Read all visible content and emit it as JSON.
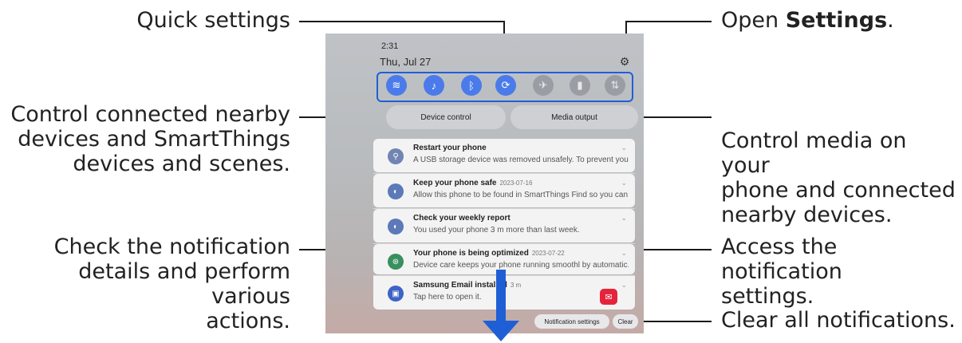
{
  "annotations": {
    "quick_settings": "Quick settings",
    "open_settings_prefix": "Open ",
    "open_settings_bold": "Settings",
    "open_settings_suffix": ".",
    "control_connected_l1": "Control connected nearby",
    "control_connected_l2": "devices and SmartThings",
    "control_connected_l3": "devices and scenes.",
    "control_media_l1": "Control media on your",
    "control_media_l2": "phone and connected",
    "control_media_l3": "nearby devices.",
    "check_notif_l1": "Check the notification",
    "check_notif_l2": "details and perform various",
    "check_notif_l3": "actions.",
    "access_notif_l1": "Access the notification",
    "access_notif_l2": "settings.",
    "clear_all": "Clear all notifications."
  },
  "phone": {
    "time": "2:31",
    "date": "Thu, Jul 27",
    "quick_settings_icons": [
      "wifi-icon",
      "sound-icon",
      "bluetooth-icon",
      "auto-rotate-icon",
      "airplane-mode-icon",
      "flashlight-icon",
      "mobile-data-icon"
    ],
    "device_control_label": "Device control",
    "media_output_label": "Media output",
    "notifications": [
      {
        "title": "Restart your phone",
        "date": "",
        "body": "A USB storage device was removed unsafely. To prevent your ...",
        "icon": "usb-icon"
      },
      {
        "title": "Keep your phone safe",
        "date": "2023-07-16",
        "body": "Allow this phone to be found in SmartThings Find so you can l...",
        "icon": "shield-icon"
      },
      {
        "title": "Check your weekly report",
        "date": "",
        "body": "You used your phone 3 m more than last week.",
        "icon": "report-icon"
      },
      {
        "title": "Your phone is being optimized",
        "date": "2023-07-22",
        "body": "Device care keeps your phone running smoothl  by automatic...",
        "icon": "device-care-icon"
      },
      {
        "title": "Samsung Email installed",
        "date": "3 m",
        "body": "Tap here to open it.",
        "icon": "bag-icon"
      }
    ],
    "notification_settings_label": "Notification settings",
    "clear_label": "Clear"
  },
  "colors": {
    "accent_blue": "#1f5fd6",
    "qs_active": "#4b7bea",
    "email_red": "#e5243b"
  }
}
